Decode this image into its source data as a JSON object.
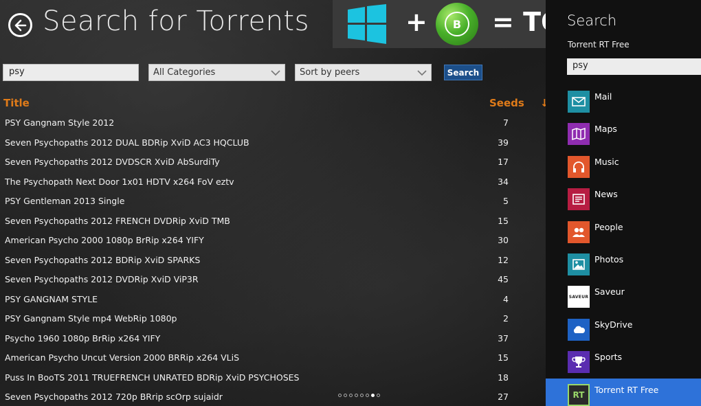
{
  "header": {
    "title": "Search for Torrents",
    "banner_plus": "+",
    "banner_equals": "= TO"
  },
  "controls": {
    "query": "psy",
    "category": "All Categories",
    "sort": "Sort by peers",
    "search_button": "Search"
  },
  "table": {
    "col_title": "Title",
    "col_seeds": "Seeds",
    "col_more": "↓",
    "rows": [
      {
        "name": "PSY Gangnam Style 2012",
        "seeds": "7"
      },
      {
        "name": "Seven Psychopaths 2012 DUAL BDRip XviD AC3 HQCLUB",
        "seeds": "39"
      },
      {
        "name": "Seven Psychopaths 2012 DVDSCR XviD AbSurdiTy",
        "seeds": "17"
      },
      {
        "name": "The Psychopath Next Door 1x01 HDTV x264 FoV eztv",
        "seeds": "34"
      },
      {
        "name": "PSY Gentleman 2013 Single",
        "seeds": "5"
      },
      {
        "name": "Seven Psychopaths 2012 FRENCH DVDRip XviD TMB",
        "seeds": "15"
      },
      {
        "name": "American Psycho 2000 1080p BrRip x264 YIFY",
        "seeds": "30"
      },
      {
        "name": "Seven Psychopaths 2012 BDRip XviD SPARKS",
        "seeds": "12"
      },
      {
        "name": "Seven Psychopaths 2012 DVDRip XviD ViP3R",
        "seeds": "45"
      },
      {
        "name": "PSY GANGNAM STYLE",
        "seeds": "4"
      },
      {
        "name": "PSY Gangnam Style mp4 WebRip 1080p",
        "seeds": "2"
      },
      {
        "name": "Psycho 1960 1080p BrRip x264 YIFY",
        "seeds": "37"
      },
      {
        "name": "American Psycho Uncut Version 2000 BRRip x264 VLiS",
        "seeds": "15"
      },
      {
        "name": "Puss In BooTS 2011 TRUEFRENCH UNRATED BDRip XviD PSYCHOSES",
        "seeds": "18"
      },
      {
        "name": "Seven Psychopaths 2012 720p BRrip scOrp sujaidr",
        "seeds": "27"
      }
    ]
  },
  "charm": {
    "title": "Search",
    "scope": "Torrent RT Free",
    "query": "psy",
    "apps": [
      {
        "label": "Mail",
        "color": "#1e8fa3",
        "icon": "mail-icon"
      },
      {
        "label": "Maps",
        "color": "#8f2db0",
        "icon": "maps-icon"
      },
      {
        "label": "Music",
        "color": "#e2572c",
        "icon": "headphones-icon"
      },
      {
        "label": "News",
        "color": "#b71d42",
        "icon": "news-icon"
      },
      {
        "label": "People",
        "color": "#e2572c",
        "icon": "people-icon"
      },
      {
        "label": "Photos",
        "color": "#1e8fa3",
        "icon": "photos-icon"
      },
      {
        "label": "Saveur",
        "color": "#ffffff",
        "icon": "saveur-icon"
      },
      {
        "label": "SkyDrive",
        "color": "#1e62c4",
        "icon": "cloud-icon"
      },
      {
        "label": "Sports",
        "color": "#5a2db0",
        "icon": "trophy-icon"
      },
      {
        "label": "Torrent RT Free",
        "color": "#2a2a2a",
        "icon": "torrent-rt-icon"
      }
    ],
    "saveur_tile_text": "SAVEUR",
    "torrent_tile_text": "RT"
  },
  "pager": {
    "count": 8,
    "active": 6
  },
  "colors": {
    "accent": "#e07b19",
    "selection": "#2e72d9",
    "button": "#1c4f8a"
  }
}
